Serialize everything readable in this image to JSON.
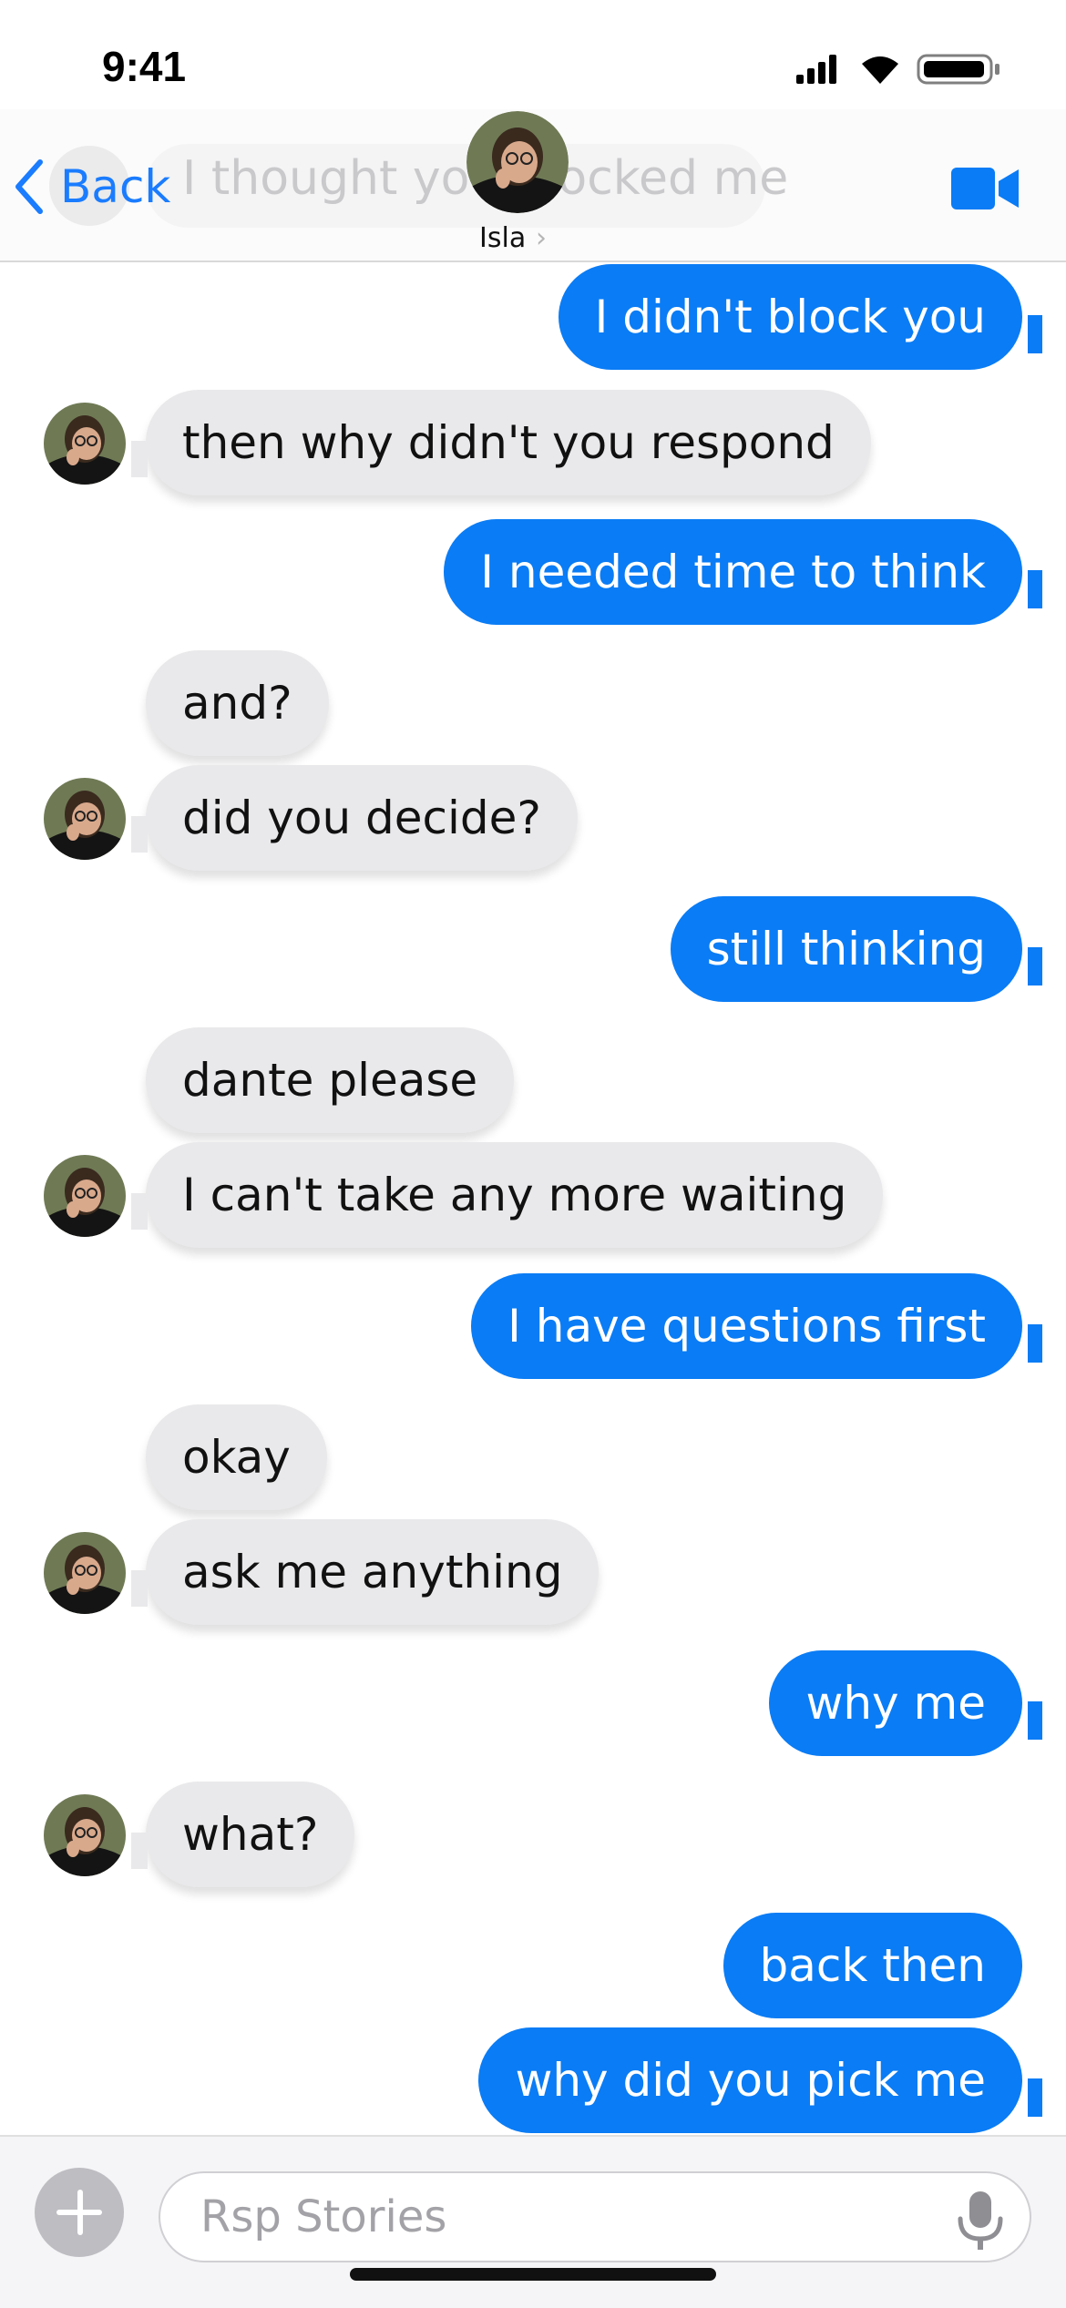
{
  "status_bar": {
    "time": "9:41"
  },
  "header": {
    "back_label": "Back",
    "ghost_preview": "I thought you blocked me",
    "contact_name": "Isla",
    "chevron": "›"
  },
  "icons": {
    "back": "chevron-left-icon",
    "video": "video-camera-icon",
    "add": "plus-icon",
    "mic": "microphone-icon"
  },
  "colors": {
    "accent": "#0a7cf5",
    "incoming_bubble": "#e9e9eb",
    "outgoing_text": "#ffffff"
  },
  "messages": [
    {
      "side": "out",
      "text": "I didn't block you"
    },
    {
      "side": "in",
      "text": "then why didn't you respond"
    },
    {
      "side": "out",
      "text": "I needed time to think"
    },
    {
      "side": "in",
      "text": "and?"
    },
    {
      "side": "in",
      "text": "did you decide?"
    },
    {
      "side": "out",
      "text": "still thinking"
    },
    {
      "side": "in",
      "text": "dante please"
    },
    {
      "side": "in",
      "text": "I can't take any more waiting"
    },
    {
      "side": "out",
      "text": "I have questions first"
    },
    {
      "side": "in",
      "text": "okay"
    },
    {
      "side": "in",
      "text": "ask me anything"
    },
    {
      "side": "out",
      "text": "why me"
    },
    {
      "side": "in",
      "text": "what?"
    },
    {
      "side": "out",
      "text": "back then"
    },
    {
      "side": "out",
      "text": "why did you pick me"
    }
  ],
  "composer": {
    "placeholder": "Rsp Stories"
  }
}
